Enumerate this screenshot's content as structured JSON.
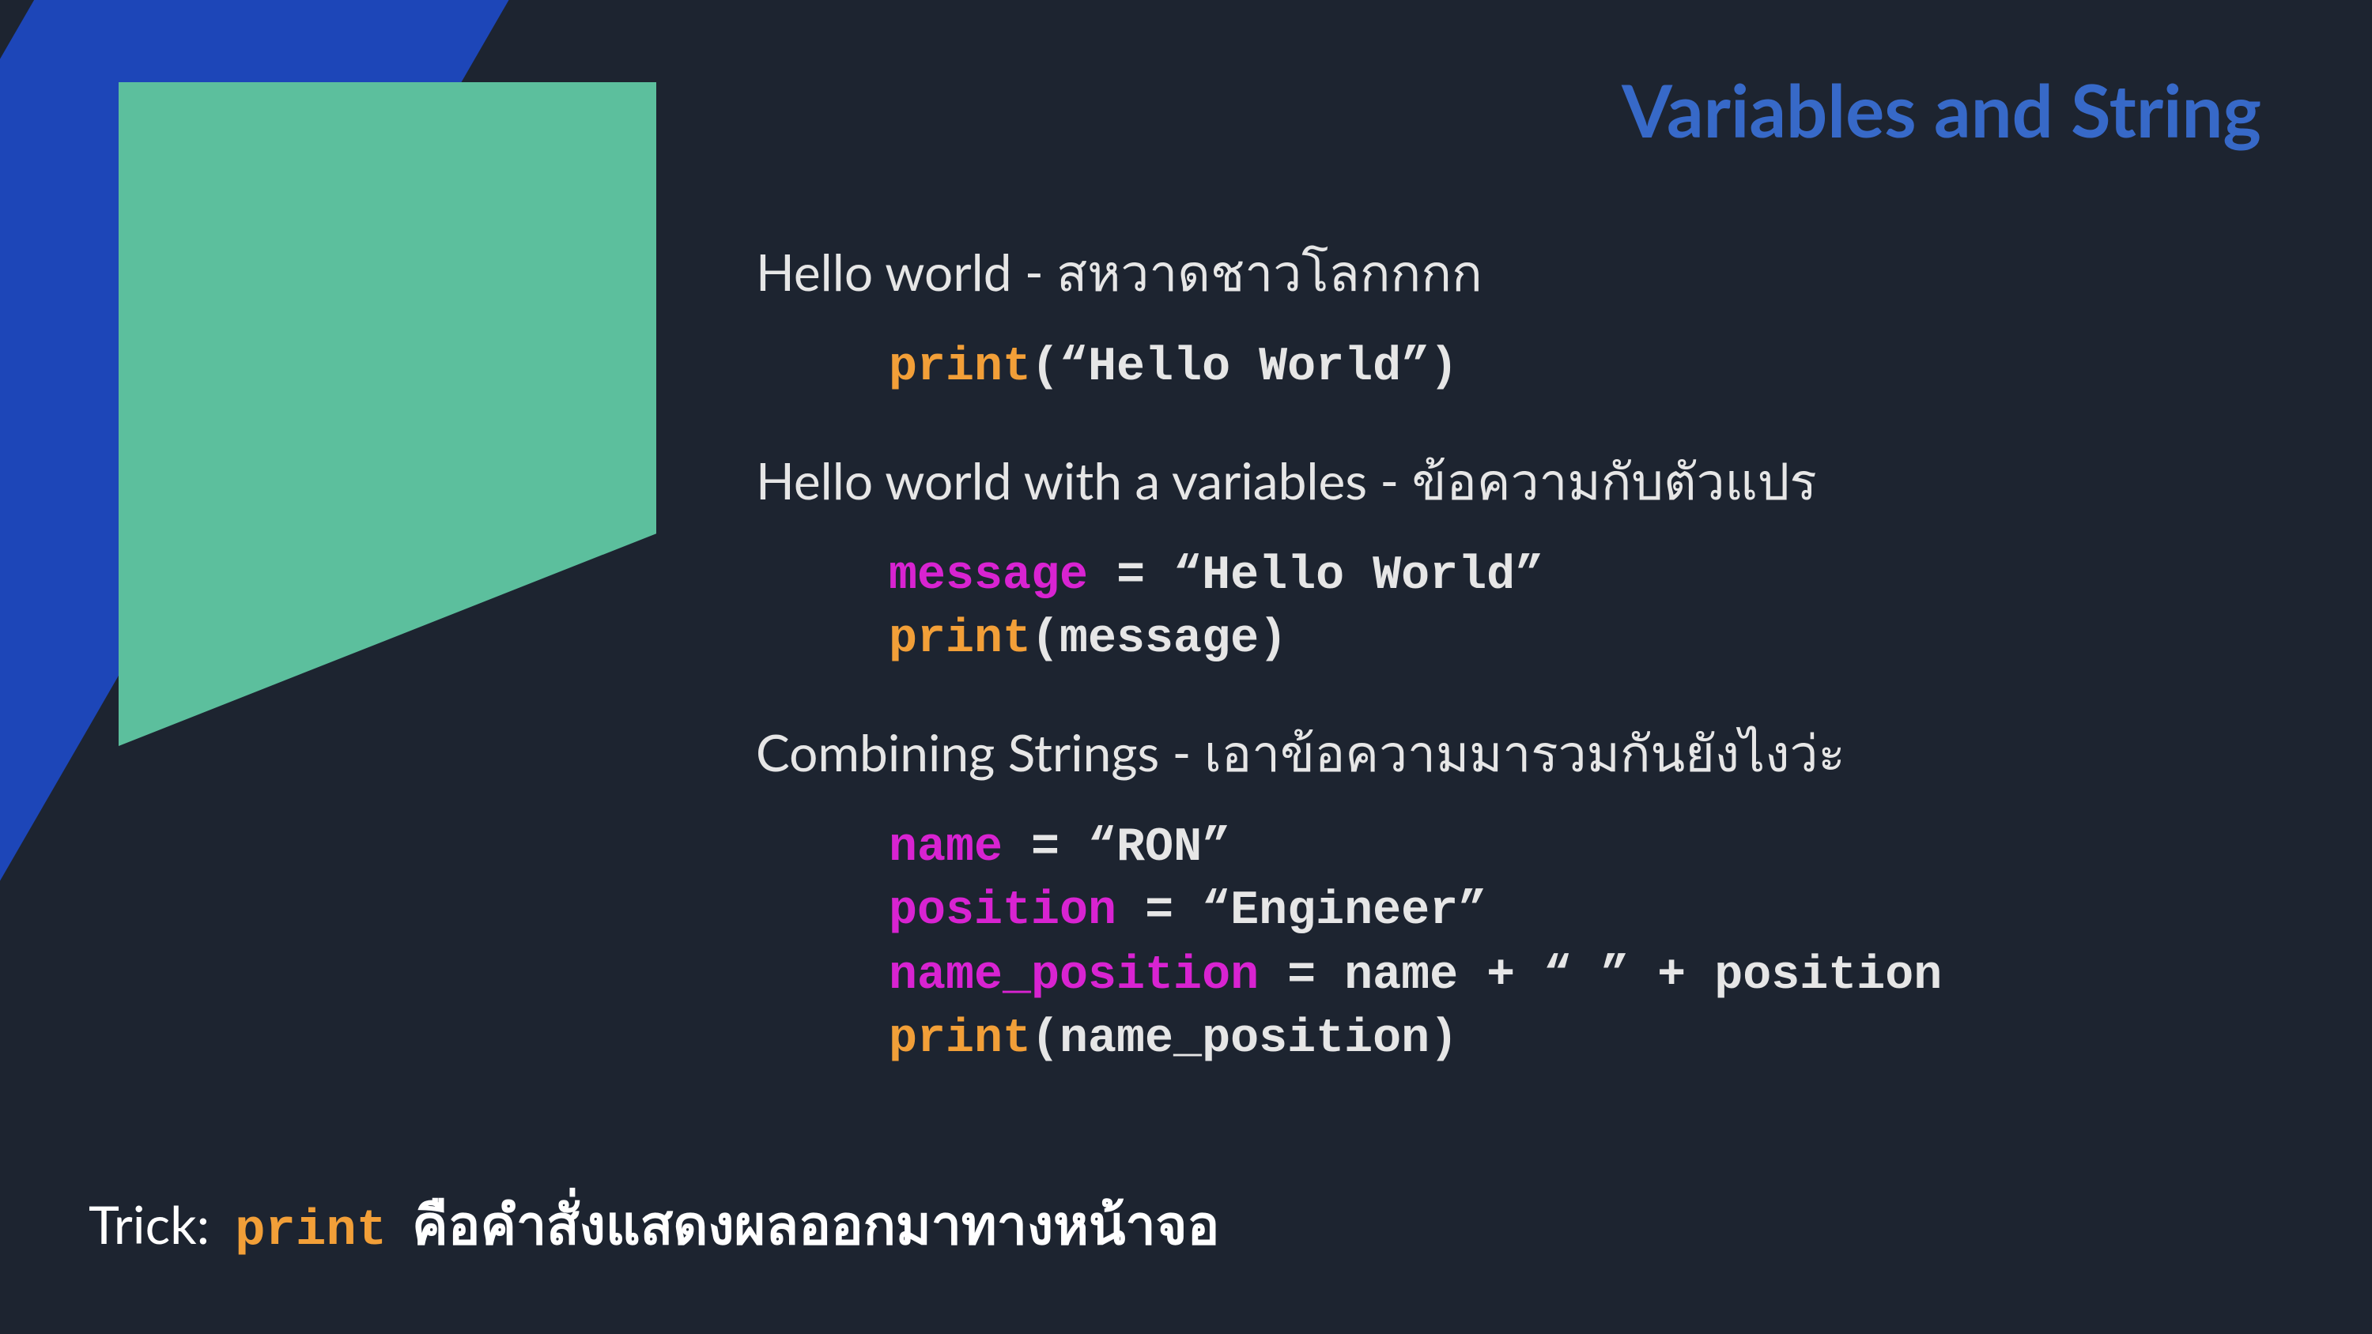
{
  "title": "Variables and String",
  "sections": [
    {
      "heading": "Hello world - สหวาดชาวโลกกกก",
      "code": [
        [
          {
            "t": "print",
            "c": "c-orange"
          },
          {
            "t": "(“Hello World”)"
          }
        ]
      ]
    },
    {
      "heading": "Hello world with a variables - ข้อความกับตัวแปร",
      "code": [
        [
          {
            "t": "message",
            "c": "c-magenta"
          },
          {
            "t": " = “Hello World”"
          }
        ],
        [
          {
            "t": "print",
            "c": "c-orange"
          },
          {
            "t": "(message)"
          }
        ]
      ]
    },
    {
      "heading": "Combining Strings - เอาข้อความมารวมกันยังไงว่ะ",
      "code": [
        [
          {
            "t": "name",
            "c": "c-magenta"
          },
          {
            "t": " = “RON”"
          }
        ],
        [
          {
            "t": "position",
            "c": "c-magenta"
          },
          {
            "t": " = “Engineer”"
          }
        ],
        [
          {
            "t": "name_position",
            "c": "c-magenta"
          },
          {
            "t": " = name + “ ” + position"
          }
        ],
        [
          {
            "t": "print",
            "c": "c-orange"
          },
          {
            "t": "(name_position)"
          }
        ]
      ]
    }
  ],
  "trick": {
    "label": "Trick:",
    "print": "print",
    "desc": "คือคำสั่งแสดงผลออกมาทางหน้าจอ"
  }
}
